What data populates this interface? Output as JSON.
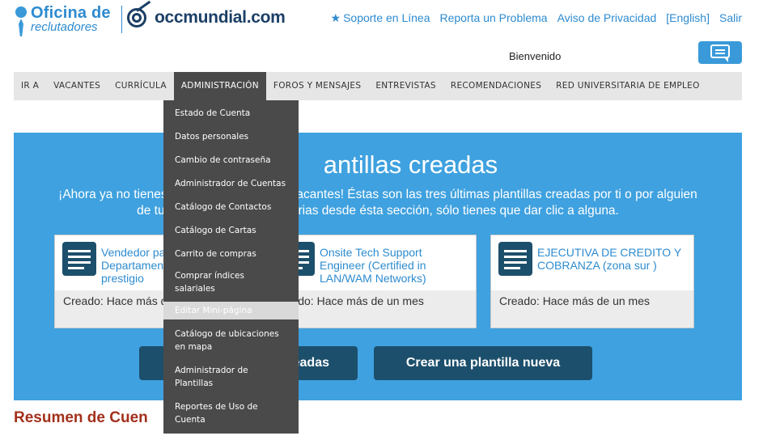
{
  "header": {
    "logo_line1": "Oficina de",
    "logo_line2": "reclutadores",
    "brand": "occmundial.com",
    "links": [
      "Soporte en Línea",
      "Reporta un Problema",
      "Aviso de Privacidad",
      "[English]",
      "Salir"
    ],
    "greeting": "Bienvenido"
  },
  "nav": {
    "items": [
      "IR A",
      "VACANTES",
      "CURRÍCULA",
      "ADMINISTRACIÓN",
      "FOROS Y MENSAJES",
      "ENTREVISTAS",
      "RECOMENDACIONES",
      "RED UNIVERSITARIA DE EMPLEO"
    ],
    "active": "ADMINISTRACIÓN"
  },
  "dropdown": {
    "items": [
      "Estado de Cuenta",
      "Datos personales",
      "Cambio de contraseña",
      "Administrador de Cuentas",
      "Catálogo de Contactos",
      "Catálogo de Cartas",
      "Carrito de compras",
      "Comprar índices salariales",
      "Editar Mini-página",
      "Catálogo de ubicaciones en mapa",
      "Administrador de Plantillas",
      "Reportes de Uso de Cuenta"
    ],
    "highlighted": "Editar Mini-página"
  },
  "banner": {
    "title_visible": "antillas creadas",
    "desc_line1_left": "¡Ahora ya no tienes c",
    "desc_line1_right": "vacantes! Éstas son las tres últimas plantillas creadas por ti o por alguien",
    "desc_line2_left": "de tu e",
    "desc_line2_right": "rias desde ésta sección, sólo tienes que dar clic a alguna.",
    "cards": [
      {
        "title": "Vendedor pa\nDepartamen\nprestigio",
        "created": "Creado: Hace más d"
      },
      {
        "title": "Onsite Tech Support\nEngineer (Certified in\nLAN/WAM Networks)",
        "created": "reado: Hace más de un mes"
      },
      {
        "title": "EJECUTIVA DE CREDITO Y\nCOBRANZA (zona sur )",
        "created": "Creado: Hace más de un mes"
      }
    ],
    "btn_left_visible": "eadas",
    "btn_right": "Crear una plantilla nueva"
  },
  "section_title_visible": "Resumen de Cuen",
  "colors": {
    "accent": "#3fa1df",
    "dark": "#1c4f6c",
    "nav_active": "#4a4a4a",
    "section_title": "#a2301c"
  }
}
